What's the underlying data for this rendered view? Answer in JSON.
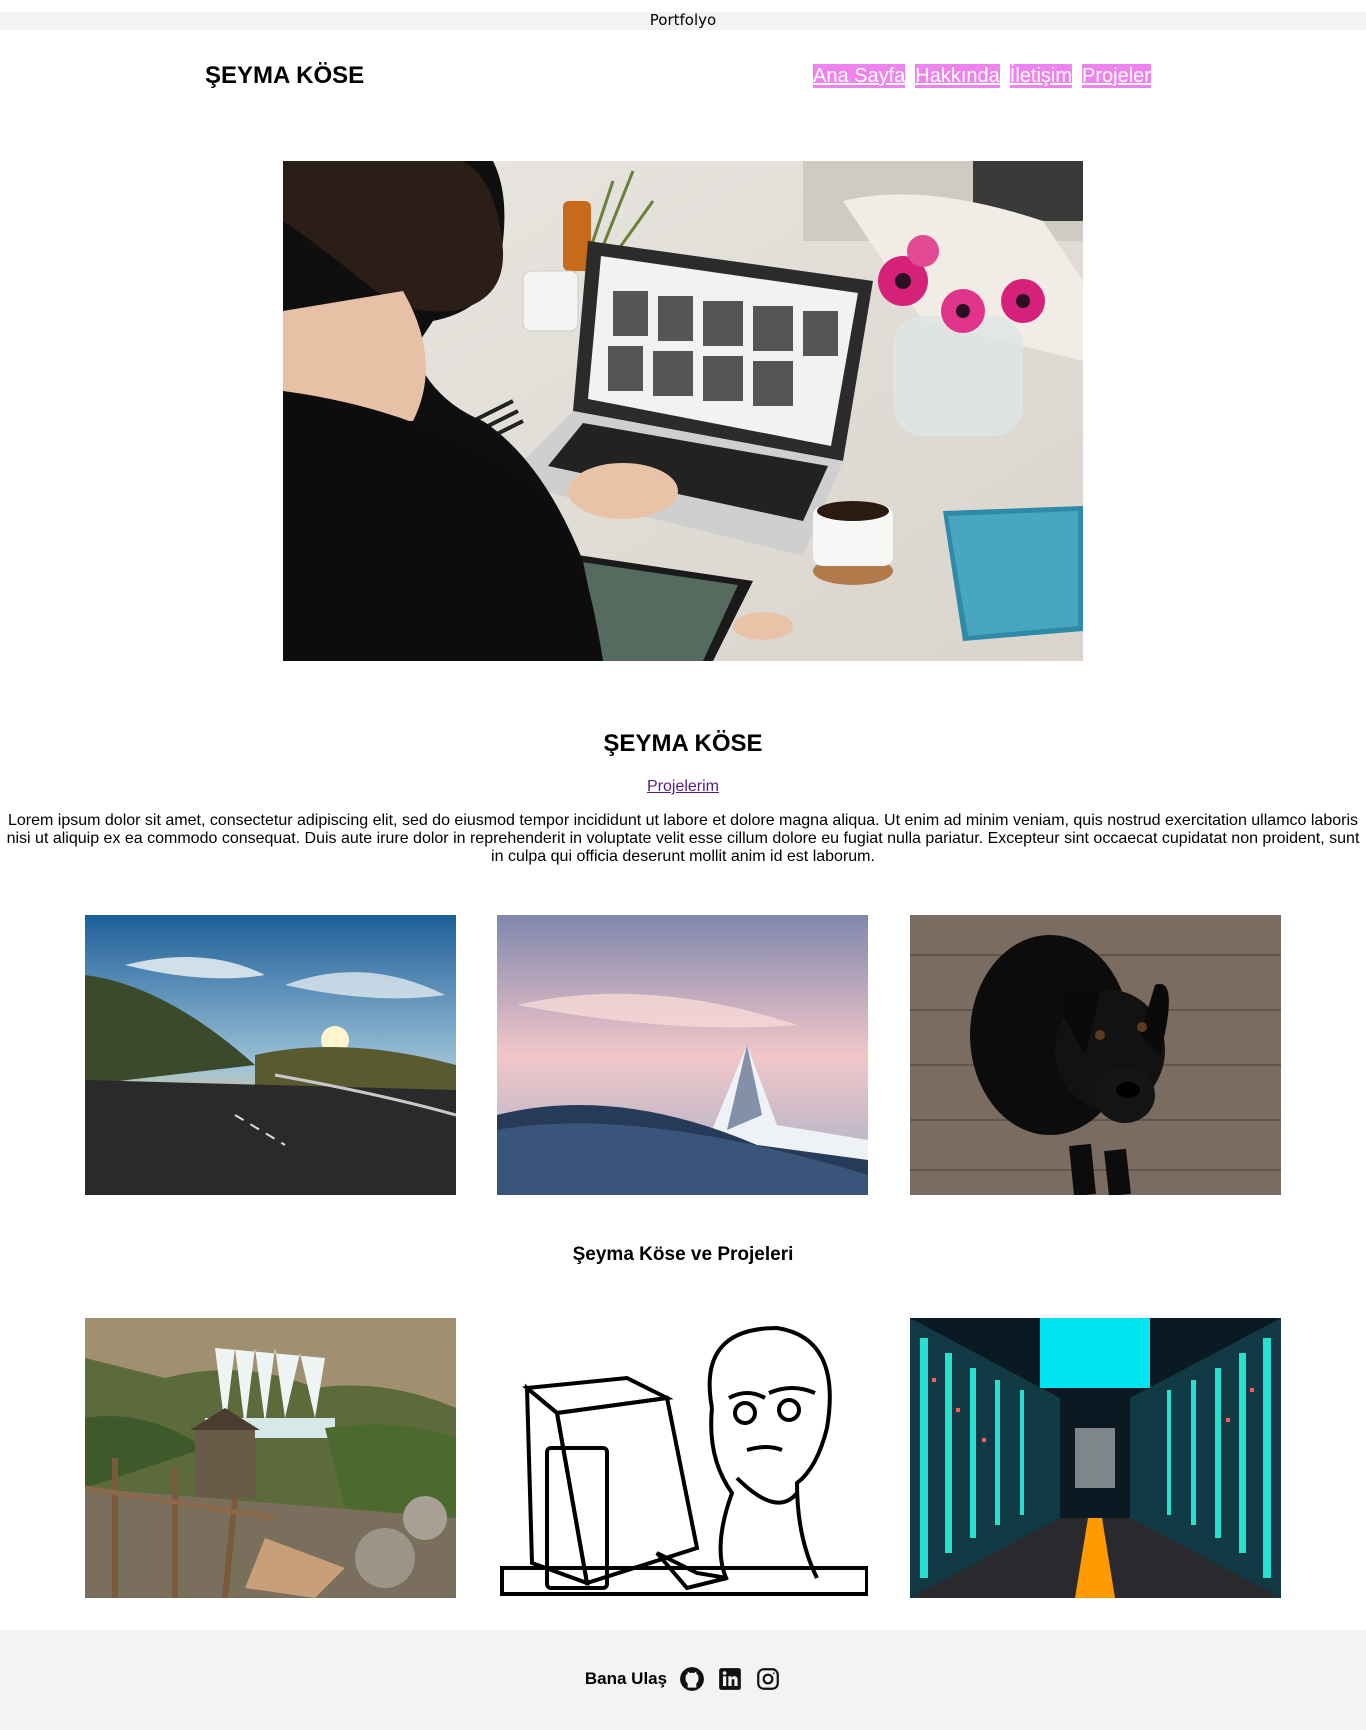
{
  "window": {
    "title": "Portfolyo"
  },
  "header": {
    "brand": "ŞEYMA KÖSE",
    "nav": [
      {
        "label": "Ana Sayfa"
      },
      {
        "label": "Hakkında"
      },
      {
        "label": "İletişim"
      },
      {
        "label": "Projeler"
      }
    ],
    "nav_bg": "#ee82ee"
  },
  "main": {
    "name": "ŞEYMA KÖSE",
    "projects_link": "Projelerim",
    "description": "Lorem ipsum dolor sit amet, consectetur adipiscing elit, sed do eiusmod tempor incididunt ut labore et dolore magna aliqua. Ut enim ad minim veniam, quis nostrud exercitation ullamco laboris nisi ut aliquip ex ea commodo consequat. Duis aute irure dolor in reprehenderit in voluptate velit esse cillum dolore eu fugiat nulla pariatur. Excepteur sint occaecat cupidatat non proident, sunt in culpa qui officia deserunt mollit anim id est laborum.",
    "subheading": "Şeyma Köse ve Projeleri"
  },
  "footer": {
    "label": "Bana Ulaş",
    "icons": [
      "github-icon",
      "linkedin-icon",
      "instagram-icon"
    ]
  }
}
